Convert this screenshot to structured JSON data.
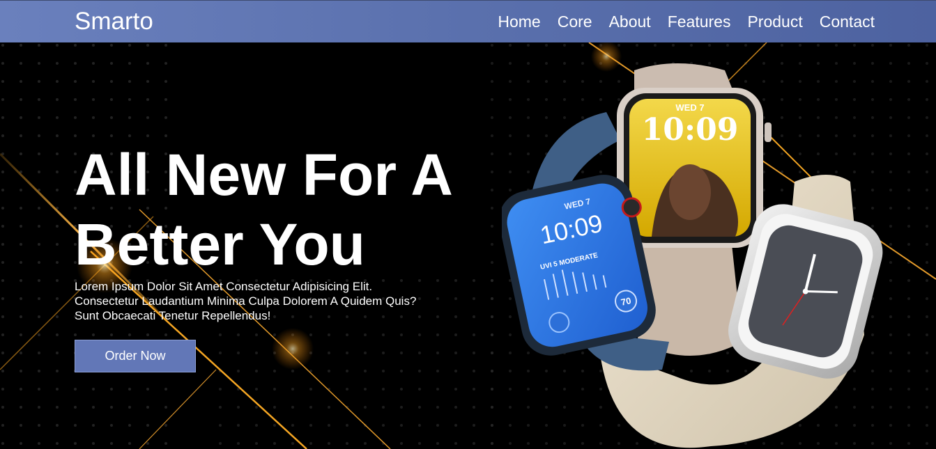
{
  "nav": {
    "logo": "Smarto",
    "links": [
      "Home",
      "Core",
      "About",
      "Features",
      "Product",
      "Contact"
    ]
  },
  "hero": {
    "headline_line1": "All New For A",
    "headline_line2": "Better You",
    "desc_line1": "Lorem Ipsum Dolor Sit Amet Consectetur Adipisicing Elit.",
    "desc_line2": "Consectetur Laudantium Minima Culpa Dolorem A Quidem Quis?",
    "desc_line3": "Sunt Obcaecati Tenetur Repellendus!",
    "cta": "Order Now"
  },
  "watches": {
    "left_watch_date": "WED 7",
    "left_watch_time": "10:09",
    "left_watch_uv": "UVI 5 MODERATE",
    "left_watch_temp": "70",
    "center_watch_date": "WED 7",
    "center_watch_time": "10:09"
  },
  "colors": {
    "nav_bg": "#5a70ad",
    "button_bg": "#6277b7",
    "accent_gold": "#f5a623"
  }
}
